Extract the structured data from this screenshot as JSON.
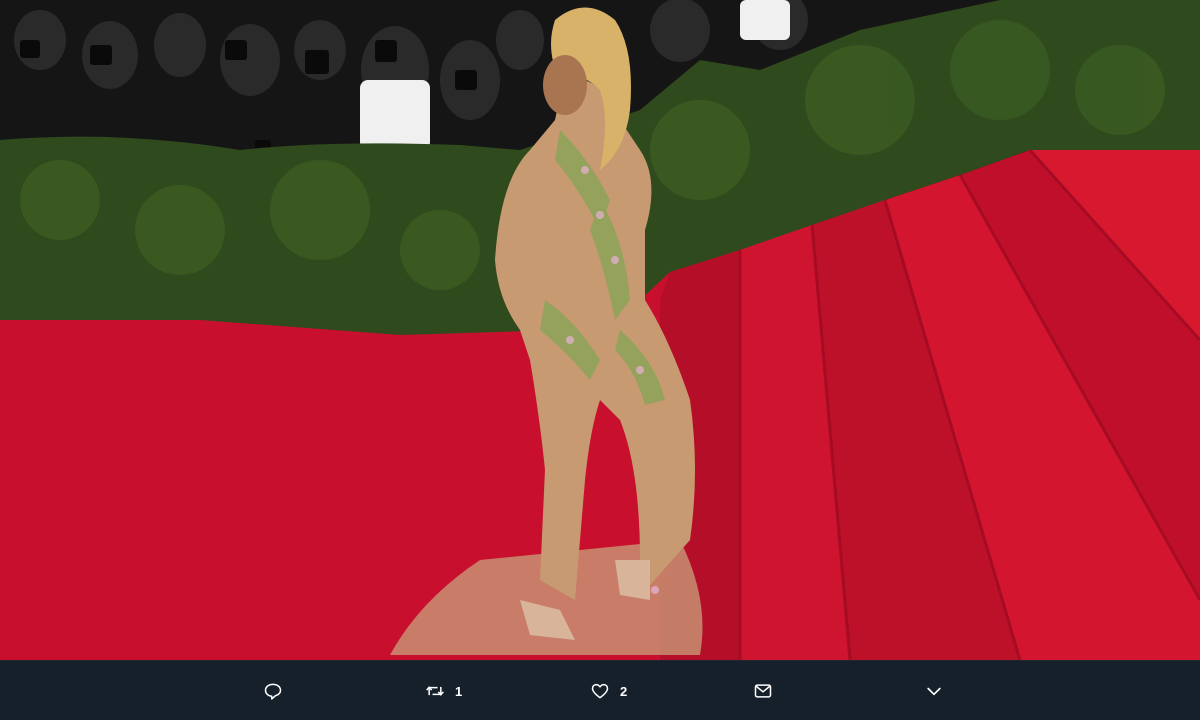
{
  "photo": {
    "alt": ""
  },
  "actions": {
    "reply": {
      "icon": "reply-icon"
    },
    "retweet": {
      "icon": "retweet-icon",
      "count": "1"
    },
    "like": {
      "icon": "heart-icon",
      "count": "2"
    },
    "share": {
      "icon": "mail-icon"
    },
    "more": {
      "icon": "chevron-down-icon"
    }
  },
  "colors": {
    "bar_background": "#15202b",
    "icon": "#ffffff",
    "carpet": "#c8102e",
    "hedge": "#2f4a1c"
  }
}
